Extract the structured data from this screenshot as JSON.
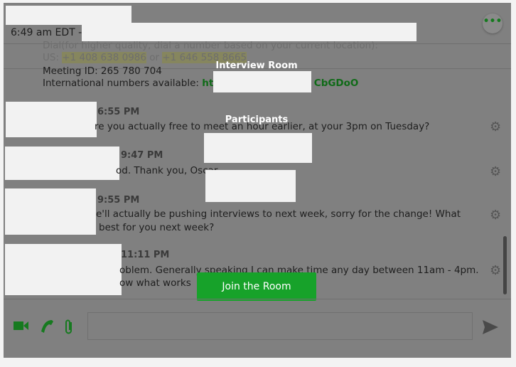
{
  "header": {
    "time_text": "6:49 am EDT -",
    "more_label": "•••"
  },
  "details": {
    "dial_line": "Dial(for higher quality, dial a number based on your current location):",
    "us_prefix": "US:",
    "phone1": "+1 408 638 0986",
    "or": "or",
    "phone2": "+1 646 558 8665",
    "meeting_id": "Meeting ID: 265 780 704",
    "intl_label": "International numbers available:",
    "intl_link_start": "htt",
    "intl_link_end": "CbGDoO"
  },
  "messages": [
    {
      "time": "6:55 PM",
      "lines": [
        "re you actually free to meet an hour earlier, at your 3pm on Tuesday?"
      ]
    },
    {
      "time": "9:47 PM",
      "lines": [
        "od. Thank you, Oscar"
      ]
    },
    {
      "time": "9:55 PM",
      "lines": [
        "e'll actually be pushing interviews to next week, sorry for the change! What",
        "best for you next week?"
      ]
    },
    {
      "time": "11:11 PM",
      "lines": [
        "oblem. Generally speaking I can make time any day between 11am - 4pm.",
        "ow what works"
      ]
    }
  ],
  "overlay": {
    "title": "Interview Room",
    "participants_label": "Participants",
    "join_label": "Join the Room"
  },
  "footer": {
    "video_icon": "video-camera-icon",
    "phone_icon": "phone-icon",
    "attach_icon": "paperclip-icon",
    "send_icon": "send-icon",
    "input_value": ""
  },
  "colors": {
    "accent": "#17a22a",
    "overlay": "#808080"
  }
}
